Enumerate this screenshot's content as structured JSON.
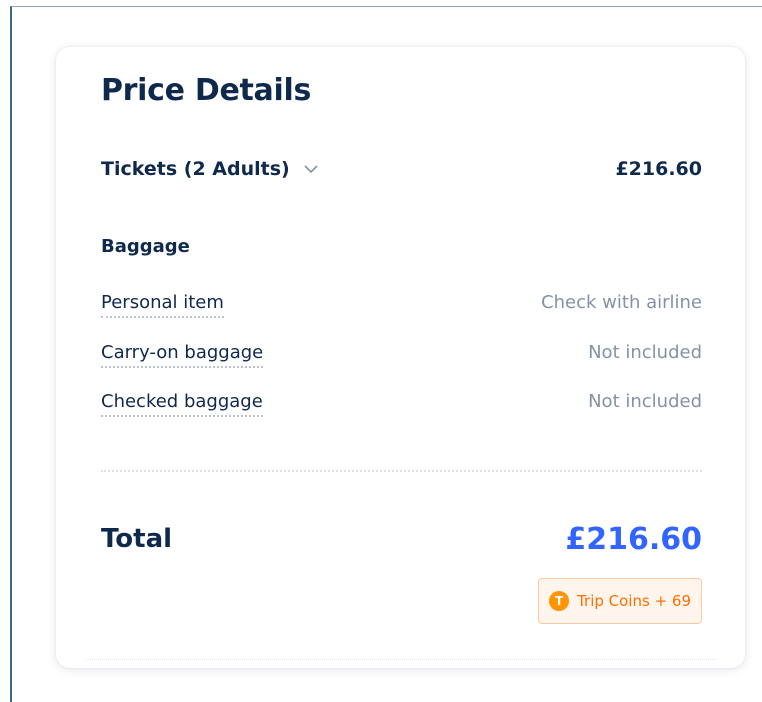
{
  "price_details": {
    "title": "Price Details",
    "tickets": {
      "label": "Tickets (2 Adults)",
      "price": "£216.60"
    },
    "baggage": {
      "title": "Baggage",
      "items": [
        {
          "label": "Personal item",
          "value": "Check with airline"
        },
        {
          "label": "Carry-on baggage",
          "value": "Not included"
        },
        {
          "label": "Checked baggage",
          "value": "Not included"
        }
      ]
    },
    "total": {
      "label": "Total",
      "price": "£216.60"
    },
    "trip_coins": {
      "icon": "coin-icon",
      "icon_glyph": "T",
      "text": "Trip Coins + 69"
    }
  },
  "colors": {
    "text_primary": "#0f294d",
    "text_secondary": "#8592a6",
    "total_accent": "#3264ff",
    "coins_orange": "#ff6f00",
    "coins_bg": "#fff5ec"
  }
}
